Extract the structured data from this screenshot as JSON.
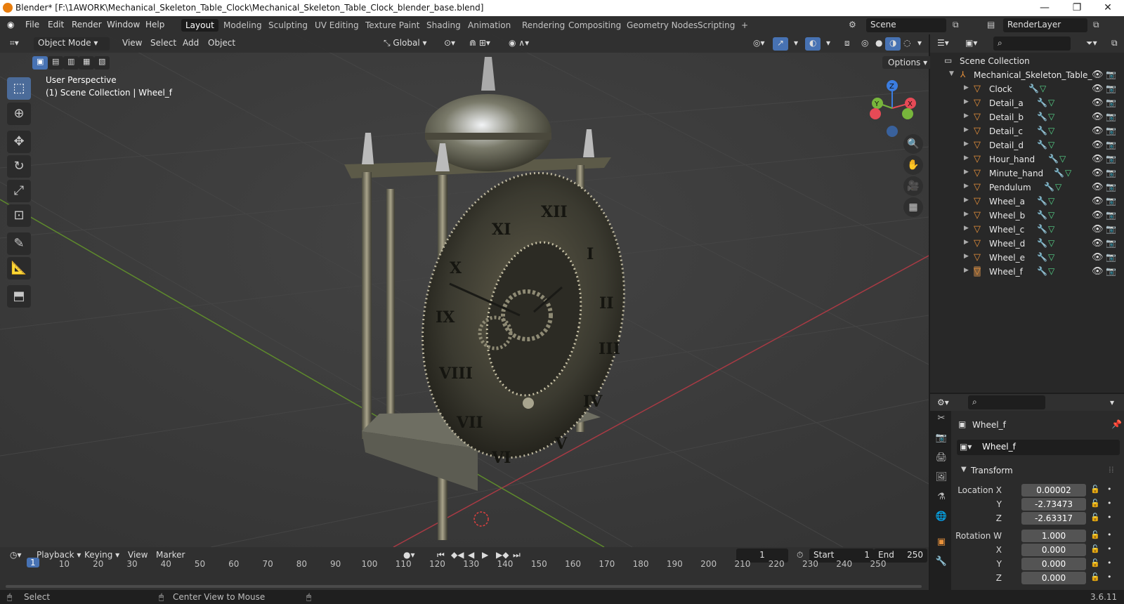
{
  "window": {
    "title": "Blender* [F:\\1AWORK\\Mechanical_Skeleton_Table_Clock\\Mechanical_Skeleton_Table_Clock_blender_base.blend]",
    "minimize": "—",
    "maximize": "❐",
    "close": "✕"
  },
  "menubar": {
    "items": [
      "File",
      "Edit",
      "Render",
      "Window",
      "Help"
    ],
    "workspaces": [
      "Layout",
      "Modeling",
      "Sculpting",
      "UV Editing",
      "Texture Paint",
      "Shading",
      "Animation",
      "Rendering",
      "Compositing",
      "Geometry Nodes",
      "Scripting"
    ],
    "active_workspace": "Layout",
    "add_workspace": "+",
    "scene": "Scene",
    "render_layer": "RenderLayer"
  },
  "viewport": {
    "mode": "Object Mode",
    "menus": [
      "View",
      "Select",
      "Add",
      "Object"
    ],
    "orientation": "Global",
    "options": "Options",
    "perspective_label": "User Perspective",
    "collection_label": "(1) Scene Collection | Wheel_f",
    "gizmo_axes": [
      "X",
      "Y",
      "Z"
    ],
    "accent": "#4772b3",
    "axis_colors": {
      "x": "#e64a56",
      "y": "#78b63c",
      "z": "#3b7de0"
    }
  },
  "outliner": {
    "root": "Scene Collection",
    "collection": "Mechanical_Skeleton_Table_",
    "objects": [
      "Clock",
      "Detail_a",
      "Detail_b",
      "Detail_c",
      "Detail_d",
      "Hour_hand",
      "Minute_hand",
      "Pendulum",
      "Wheel_a",
      "Wheel_b",
      "Wheel_c",
      "Wheel_d",
      "Wheel_e",
      "Wheel_f"
    ],
    "selected": "Wheel_f"
  },
  "properties": {
    "object_name": "Wheel_f",
    "data_name": "Wheel_f",
    "panel": "Transform",
    "location": {
      "label_x": "Location X",
      "x": "0.00002",
      "label_y": "Y",
      "y": "-2.73473",
      "label_z": "Z",
      "z": "-2.63317"
    },
    "rotation": {
      "label_w": "Rotation W",
      "w": "1.000",
      "label_x": "X",
      "x": "0.000",
      "label_y": "Y",
      "y": "0.000",
      "label_z": "Z",
      "z": "0.000"
    }
  },
  "timeline": {
    "menus": [
      "Playback",
      "Keying",
      "View",
      "Marker"
    ],
    "current_frame": "1",
    "start_label": "Start",
    "start": "1",
    "end_label": "End",
    "end": "250",
    "ticks": [
      "1",
      "10",
      "20",
      "30",
      "40",
      "50",
      "60",
      "70",
      "80",
      "90",
      "100",
      "110",
      "120",
      "130",
      "140",
      "150",
      "160",
      "170",
      "180",
      "190",
      "200",
      "210",
      "220",
      "230",
      "240",
      "250"
    ]
  },
  "statusbar": {
    "left": "Select",
    "middle": "Center View to Mouse",
    "version": "3.6.11"
  }
}
